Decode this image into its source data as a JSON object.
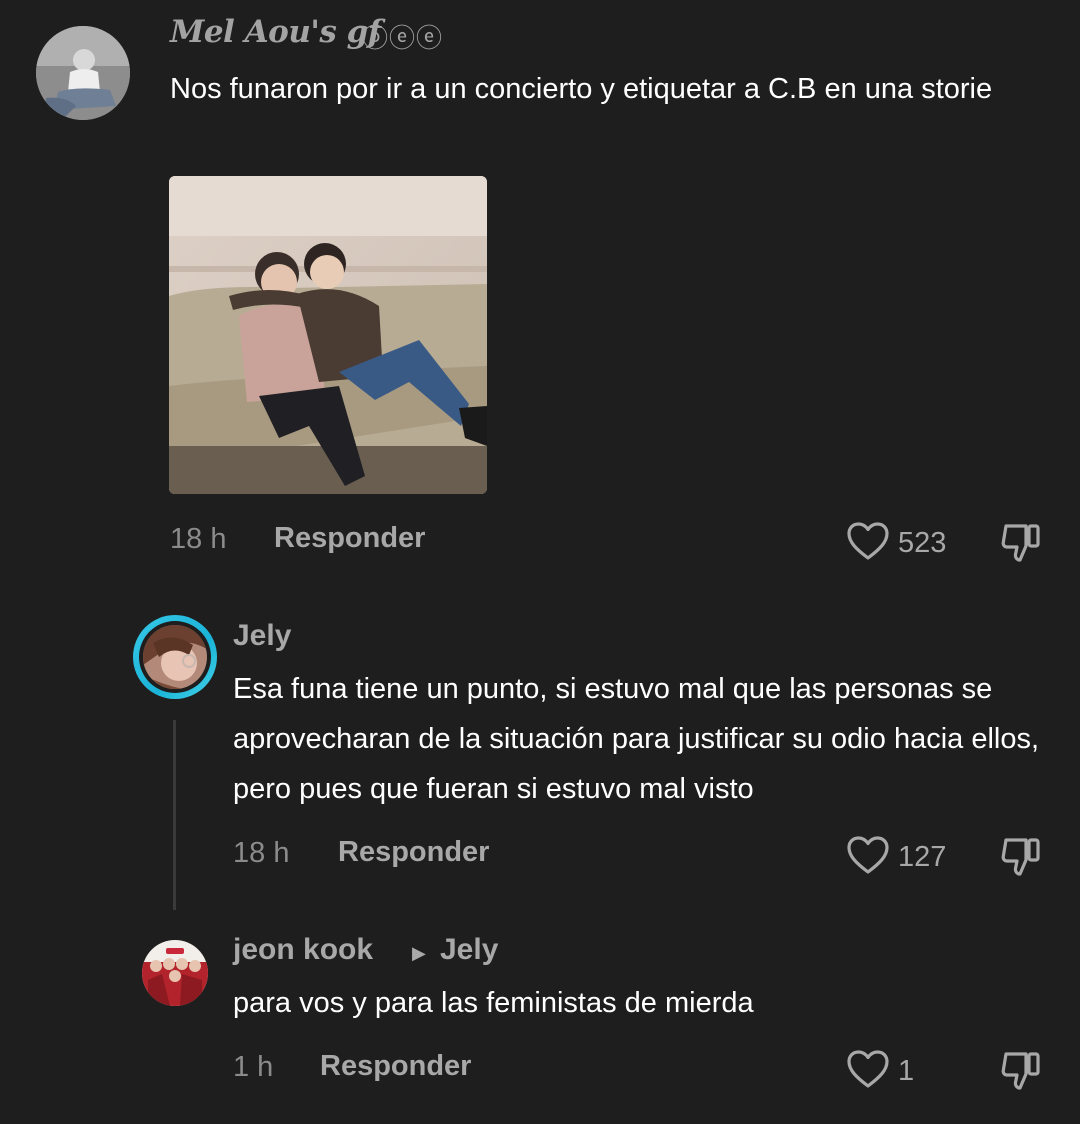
{
  "comments": [
    {
      "username": "Mel Aou's gf",
      "username_decoration": "ⓞⓔⓔ",
      "text": "Nos funaron por ir a un concierto y etiquetar a C.B en una storie",
      "time": "18 h",
      "reply_label": "Responder",
      "likes": "523"
    },
    {
      "username": "Jely",
      "text": "Esa funa tiene un punto, si estuvo mal que las personas se aprovecharan de la situación para justificar su odio hacia ellos, pero pues que fueran si estuvo mal visto",
      "time": "18 h",
      "reply_label": "Responder",
      "likes": "127"
    },
    {
      "username": "jeon kook",
      "reply_to": "Jely",
      "text": "para vos y para las feministas de mierda",
      "time": "1 h",
      "reply_label": "Responder",
      "likes": "1"
    }
  ],
  "icons": {
    "like": "heart-outline-icon",
    "dislike": "thumbs-down-icon",
    "reply_arrow": "play-triangle-icon"
  },
  "colors": {
    "background": "#1e1e1e",
    "primary_text": "#ffffff",
    "secondary_text": "#a8a8a8",
    "story_ring": "#1ab3d7"
  }
}
